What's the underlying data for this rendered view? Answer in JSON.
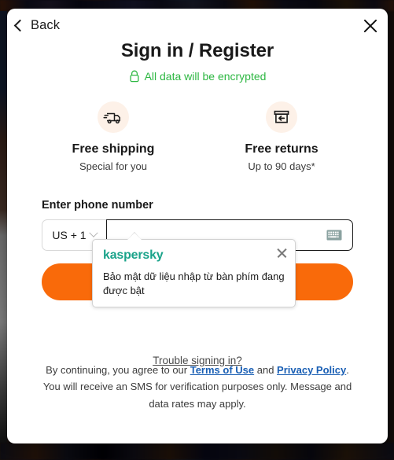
{
  "modal": {
    "back_label": "Back",
    "title": "Sign in / Register",
    "encrypted_note": "All data will be encrypted",
    "back_icon": "chevron-left-icon",
    "close_icon": "close-icon",
    "lock_icon": "lock-icon",
    "accent_green": "#2db742"
  },
  "benefits": [
    {
      "icon": "truck-icon",
      "title": "Free shipping",
      "subtitle": "Special for you"
    },
    {
      "icon": "return-box-icon",
      "title": "Free returns",
      "subtitle": "Up to 90 days*"
    }
  ],
  "phone": {
    "label": "Enter phone number",
    "country_code": "US + 1",
    "chevron_icon": "chevron-down-icon",
    "input_value": "",
    "input_placeholder": "",
    "keyboard_icon": "keyboard-icon"
  },
  "submit": {
    "label": "",
    "color": "#f96a0a"
  },
  "kaspersky_tooltip": {
    "brand": "kaspersky",
    "message": "Bảo mật dữ liệu nhập từ bàn phím đang được bật",
    "close_icon": "close-icon",
    "brand_color": "#1aa38a"
  },
  "trouble": {
    "label": "Trouble signing in?"
  },
  "footer": {
    "part1": "By continuing, you agree to our ",
    "terms_link": "Terms of Use",
    "part2": " and ",
    "privacy_link": "Privacy Policy",
    "part3": ". You will receive an SMS for verification purposes only. Message and data rates may apply.",
    "link_color": "#1a5fb4"
  }
}
